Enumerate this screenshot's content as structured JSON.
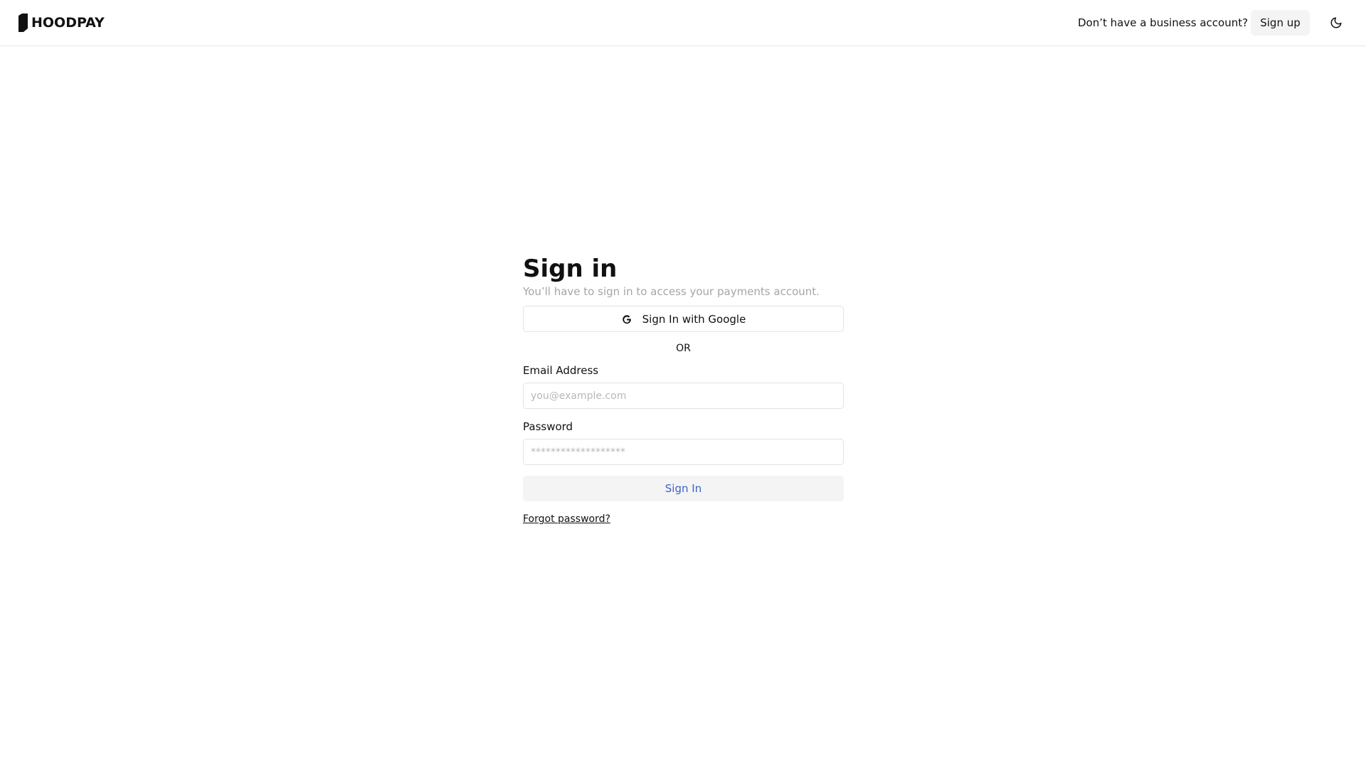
{
  "header": {
    "brand": "HOODPAY",
    "prompt": "Don’t have a business account?",
    "signup_label": "Sign up",
    "theme_icon": "moon-icon"
  },
  "signin": {
    "title": "Sign in",
    "subtitle": "You’ll have to sign in to access your payments account.",
    "google_label": "Sign In with Google",
    "google_icon": "google-icon",
    "divider": "OR",
    "email_label": "Email Address",
    "email_placeholder": "you@example.com",
    "email_value": "",
    "password_label": "Password",
    "password_placeholder": "*******************",
    "password_value": "",
    "submit_label": "Sign In",
    "forgot_label": "Forgot password?"
  },
  "colors": {
    "background": "#ffffff",
    "text": "#111111",
    "muted_text": "#a6a6a6",
    "button_bg": "#f4f4f4",
    "submit_text": "#3a64c8",
    "border": "#e2e2e2"
  }
}
